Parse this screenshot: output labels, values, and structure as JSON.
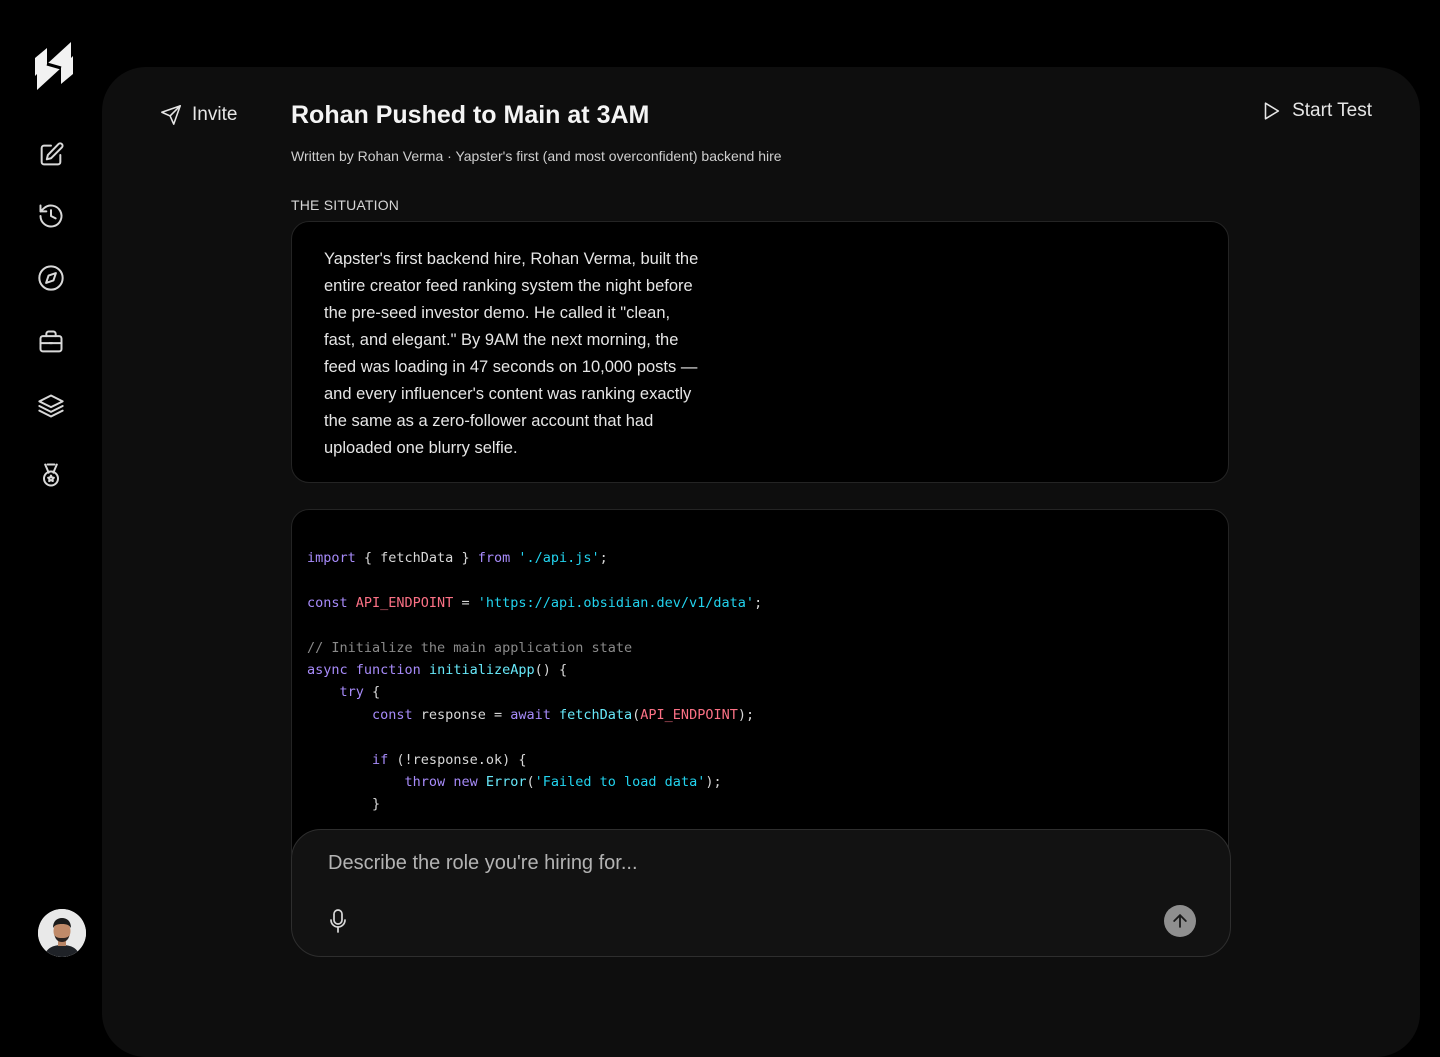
{
  "header": {
    "invite_label": "Invite",
    "start_test_label": "Start Test"
  },
  "article": {
    "title": "Rohan Pushed to Main at 3AM",
    "byline": "Written by Rohan Verma · Yapster's first (and most overconfident) backend hire",
    "section_label": "THE SITUATION",
    "situation_text": "Yapster's first backend hire, Rohan Verma, built the entire creator feed ranking system the night before the pre-seed investor demo. He called it \"clean, fast, and elegant.\" By 9AM the next morning, the feed was loading in 47 seconds on 10,000 posts — and every influencer's content was ranking exactly the same as a zero-follower account that had uploaded one blurry selfie."
  },
  "code": {
    "lines": [
      "import { fetchData } from './api.js';",
      "const API_ENDPOINT = 'https://api.obsidian.dev/v1/data';",
      "// Initialize the main application state",
      "async function initializeApp() {",
      "try {",
      "const response = await fetchData(API_ENDPOINT);",
      "if (!response.ok) {",
      "throw new Error('Failed to load data');",
      "}"
    ]
  },
  "composer": {
    "placeholder": "Describe the role you're hiring for..."
  },
  "sidebar": {
    "items": [
      {
        "icon": "edit-icon"
      },
      {
        "icon": "history-icon"
      },
      {
        "icon": "compass-icon"
      },
      {
        "icon": "briefcase-icon"
      },
      {
        "icon": "layers-icon"
      },
      {
        "icon": "medal-icon"
      }
    ]
  },
  "colors": {
    "background": "#000000",
    "panel": "#0e0e0e",
    "keyword": "#a78bfa",
    "string": "#22d3ee",
    "constant": "#fb7185",
    "comment": "#8a8a8a"
  }
}
